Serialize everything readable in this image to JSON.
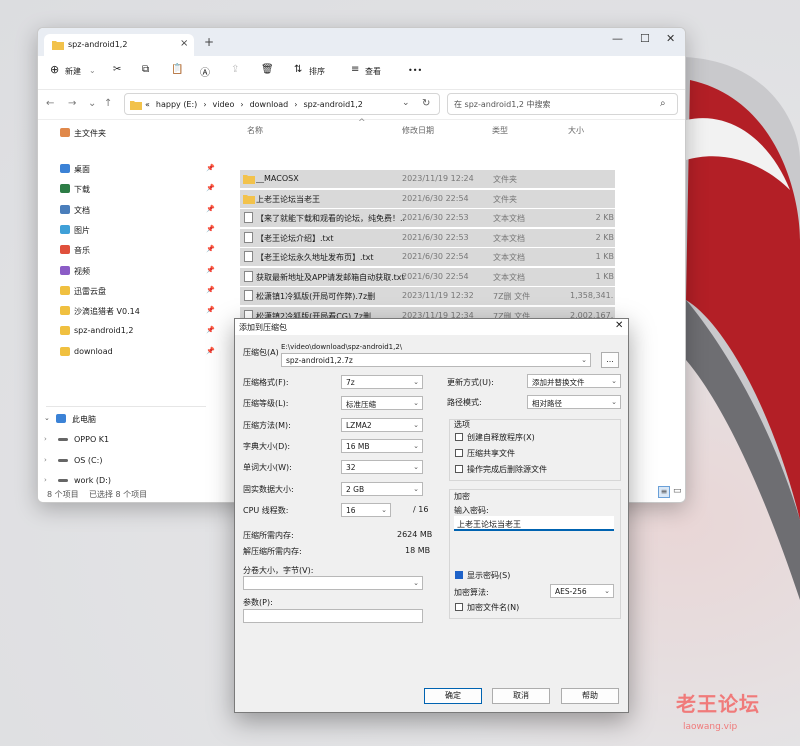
{
  "explorer": {
    "tab_title": "spz-android1,2",
    "toolbar": {
      "new": "新建",
      "sort": "排序",
      "view": "查看",
      "more": "•••"
    },
    "address_segments": [
      "«",
      "happy (E:)",
      "›",
      "video",
      "›",
      "download",
      "›",
      "spz-android1,2"
    ],
    "search_placeholder": "在 spz-android1,2 中搜索",
    "sidebar": {
      "home": "主文件夹",
      "items": [
        {
          "label": "桌面",
          "icon": "desktop-icon",
          "color": "#3b82d6"
        },
        {
          "label": "下载",
          "icon": "download-icon",
          "color": "#2d7d46"
        },
        {
          "label": "文档",
          "icon": "document-icon",
          "color": "#4a7ebb"
        },
        {
          "label": "图片",
          "icon": "pictures-icon",
          "color": "#3fa0d8"
        },
        {
          "label": "音乐",
          "icon": "music-icon",
          "color": "#e0503c"
        },
        {
          "label": "视频",
          "icon": "video-icon",
          "color": "#8b5cc6"
        },
        {
          "label": "迅雷云盘",
          "icon": "folder-icon",
          "color": "#f0c040"
        },
        {
          "label": "沙滴追猎者 V0.14",
          "icon": "folder-icon",
          "color": "#f0c040"
        },
        {
          "label": "spz-android1,2",
          "icon": "folder-icon",
          "color": "#f0c040"
        },
        {
          "label": "download",
          "icon": "folder-icon",
          "color": "#f0c040"
        }
      ],
      "this_pc": "此电脑",
      "drives": [
        "OPPO K1",
        "OS (C:)",
        "work (D:)",
        "happy (E:)"
      ]
    },
    "columns": [
      "名称",
      "修改日期",
      "类型",
      "大小"
    ],
    "files": [
      {
        "name": "__MACOSX",
        "date": "2023/11/19 12:24",
        "type": "文件夹",
        "size": "",
        "kind": "folder"
      },
      {
        "name": "上老王论坛当老王",
        "date": "2021/6/30 22:54",
        "type": "文件夹",
        "size": "",
        "kind": "folder"
      },
      {
        "name": "【来了就能下载和观看的论坛，纯免费！...",
        "date": "2021/6/30 22:53",
        "type": "文本文档",
        "size": "2 KB",
        "kind": "txt"
      },
      {
        "name": "【老王论坛介绍】.txt",
        "date": "2021/6/30 22:53",
        "type": "文本文档",
        "size": "2 KB",
        "kind": "txt"
      },
      {
        "name": "【老王论坛永久地址发布页】.txt",
        "date": "2021/6/30 22:54",
        "type": "文本文档",
        "size": "1 KB",
        "kind": "txt"
      },
      {
        "name": "获取最新地址及APP请发邮箱自动获取.txt",
        "date": "2021/6/30 22:54",
        "type": "文本文档",
        "size": "1 KB",
        "kind": "txt"
      },
      {
        "name": "松潇镇1冷狐版(开局可作弊).7z删",
        "date": "2023/11/19 12:32",
        "type": "7Z删 文件",
        "size": "1,358,341...",
        "kind": "7z"
      },
      {
        "name": "松潇镇2冷狐版(开局看CG).7z删",
        "date": "2023/11/19 12:34",
        "type": "7Z删 文件",
        "size": "2,002,167...",
        "kind": "7z"
      }
    ],
    "status": {
      "count": "8 个项目",
      "selected": "已选择 8 个项目"
    }
  },
  "dialog": {
    "title": "添加到压缩包",
    "archive_label": "压缩包(A)",
    "archive_path": "E:\\video\\download\\spz-android1,2\\",
    "archive_name": "spz-android1,2.7z",
    "browse": "...",
    "fields": [
      {
        "label": "压缩格式(F):",
        "value": "7z"
      },
      {
        "label": "压缩等级(L):",
        "value": "标准压缩"
      },
      {
        "label": "压缩方法(M):",
        "value": "LZMA2"
      },
      {
        "label": "字典大小(D):",
        "value": "16 MB"
      },
      {
        "label": "单词大小(W):",
        "value": "32"
      },
      {
        "label": "固实数据大小:",
        "value": "2 GB"
      }
    ],
    "cpu_label": "CPU 线程数:",
    "cpu_value": "16",
    "cpu_total": "/ 16",
    "mem_compress_label": "压缩所需内存:",
    "mem_compress_value": "2624 MB",
    "mem_decompress_label": "解压缩所需内存:",
    "mem_decompress_value": "18 MB",
    "split_label": "分卷大小，字节(V):",
    "split_value": "",
    "params_label": "参数(P):",
    "params_value": "",
    "update_label": "更新方式(U):",
    "update_value": "添加并替换文件",
    "path_label": "路径模式:",
    "path_value": "相对路径",
    "options_title": "选项",
    "options": [
      {
        "label": "创建自释放程序(X)",
        "checked": false
      },
      {
        "label": "压缩共享文件",
        "checked": false
      },
      {
        "label": "操作完成后删除源文件",
        "checked": false
      }
    ],
    "encrypt_title": "加密",
    "password_label": "输入密码:",
    "password_value": "上老王论坛当老王",
    "show_password": "显示密码(S)",
    "show_password_checked": true,
    "algo_label": "加密算法:",
    "algo_value": "AES-256",
    "encrypt_names": "加密文件名(N)",
    "encrypt_names_checked": false,
    "ok": "确定",
    "cancel": "取消",
    "help": "帮助"
  },
  "watermark": {
    "cn": "老王论坛",
    "url": "laowang.vip"
  }
}
